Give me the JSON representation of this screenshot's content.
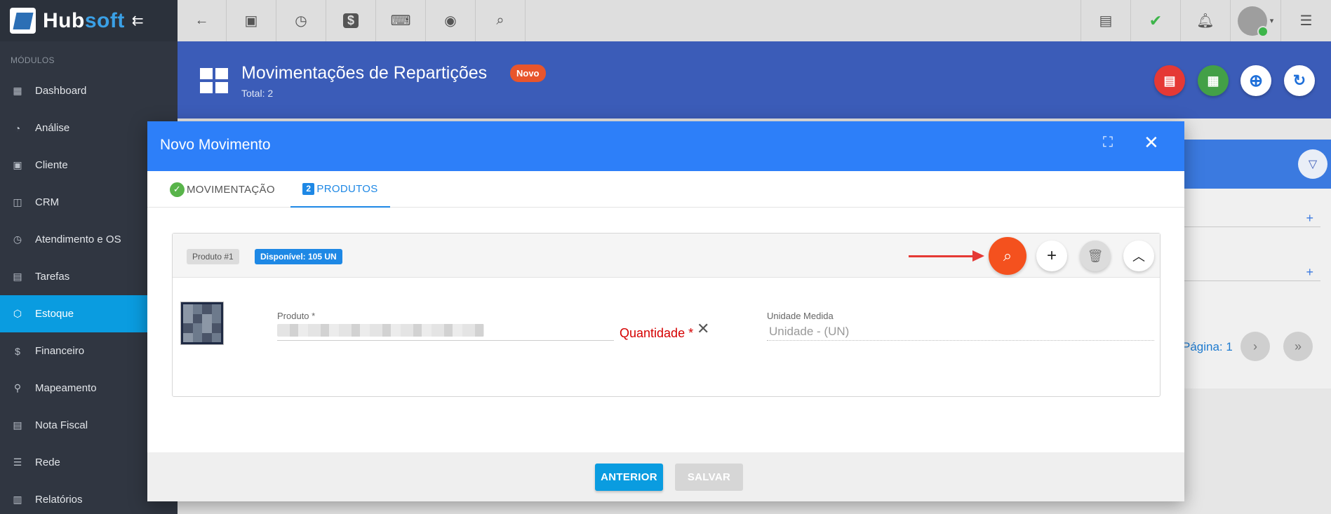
{
  "logo": {
    "part1": "Hub",
    "part2": "soft"
  },
  "sidebar": {
    "section_label": "MÓDULOS",
    "items": [
      {
        "label": "Dashboard",
        "icon": "grid-icon"
      },
      {
        "label": "Análise",
        "icon": "pie-chart-icon"
      },
      {
        "label": "Cliente",
        "icon": "contact-card-icon"
      },
      {
        "label": "CRM",
        "icon": "kanban-icon"
      },
      {
        "label": "Atendimento e OS",
        "icon": "calendar-clock-icon"
      },
      {
        "label": "Tarefas",
        "icon": "briefcase-icon"
      },
      {
        "label": "Estoque",
        "icon": "box-icon",
        "active": true
      },
      {
        "label": "Financeiro",
        "icon": "money-icon"
      },
      {
        "label": "Mapeamento",
        "icon": "map-pin-icon"
      },
      {
        "label": "Nota Fiscal",
        "icon": "document-icon"
      },
      {
        "label": "Rede",
        "icon": "server-icon"
      },
      {
        "label": "Relatórios",
        "icon": "report-icon"
      }
    ]
  },
  "header": {
    "title": "Movimentações de Repartições",
    "badge": "Novo",
    "total": "Total: 2",
    "colors": {
      "pdf": "#e53935",
      "excel": "#43a047",
      "add": "#ffffff",
      "refresh": "#ffffff"
    }
  },
  "background_panel": {
    "pagina": "Página: 1"
  },
  "modal": {
    "title": "Novo Movimento",
    "tabs": [
      {
        "label": "MOVIMENTAÇÃO"
      },
      {
        "label": "PRODUTOS",
        "number": "2"
      }
    ],
    "product": {
      "chip": "Produto #1",
      "available": "Disponível: 105 UN",
      "produto_label": "Produto",
      "required_mark": "*",
      "quantidade_label": "Quantidade",
      "unidade_label": "Unidade Medida",
      "unidade_value": "Unidade - (UN)"
    },
    "footer": {
      "prev": "ANTERIOR",
      "save": "SALVAR"
    }
  }
}
